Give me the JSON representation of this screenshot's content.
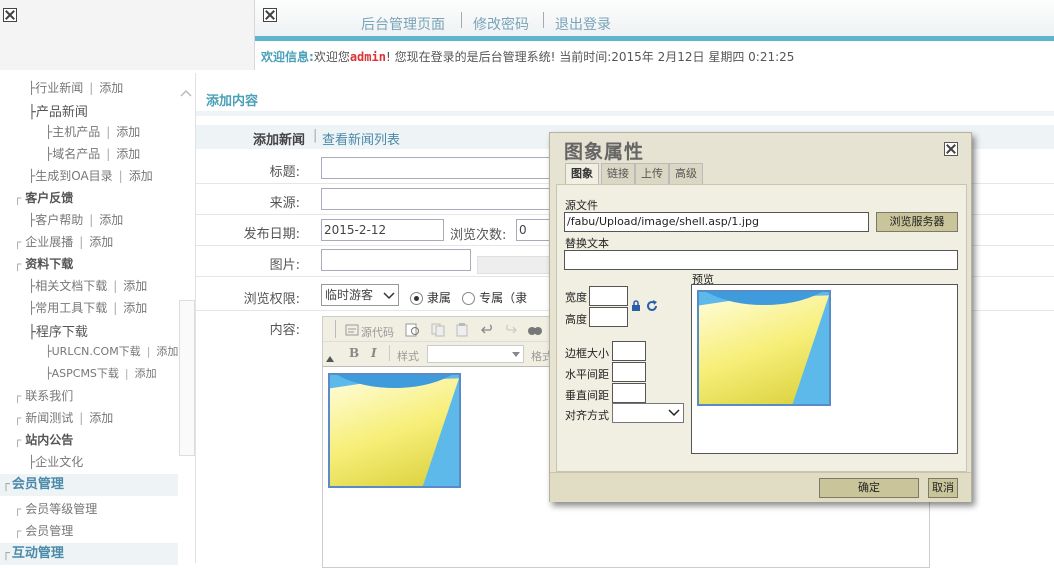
{
  "top_nav": [
    "后台管理页面",
    "修改密码",
    "退出登录"
  ],
  "welcome": {
    "label": "欢迎信息:",
    "prefix": "欢迎您",
    "user": "admin",
    "rest": "! 您现在登录的是后台管理系统! 当前时间:2015年 2月12日 星期四 0:21:25"
  },
  "sidebar": {
    "items": [
      {
        "name": "├行业新闻",
        "action": "添加"
      },
      {
        "name": "├产品新闻",
        "action": ""
      },
      {
        "name": "├主机产品",
        "action": "添加"
      },
      {
        "name": "├域名产品",
        "action": "添加"
      },
      {
        "name": "├生成到OA目录",
        "action": "添加"
      },
      {
        "name": "客户反馈",
        "action": ""
      },
      {
        "name": "├客户帮助",
        "action": "添加"
      },
      {
        "name": "企业展播",
        "action": "添加"
      },
      {
        "name": "资料下载",
        "action": ""
      },
      {
        "name": "├相关文档下载",
        "action": "添加"
      },
      {
        "name": "├常用工具下载",
        "action": "添加"
      },
      {
        "name": "├程序下载",
        "action": ""
      },
      {
        "name": "├URLCN.COM下载",
        "action": "添加"
      },
      {
        "name": "├ASPCMS下载",
        "action": "添加"
      },
      {
        "name": "联系我们",
        "action": ""
      },
      {
        "name": "新闻测试",
        "action": "添加"
      },
      {
        "name": "站内公告",
        "action": ""
      },
      {
        "name": "├企业文化",
        "action": ""
      }
    ],
    "member_section": "会员管理",
    "member_items": [
      "会员等级管理",
      "会员管理"
    ],
    "interact_section": "互动管理"
  },
  "main": {
    "title": "添加内容",
    "tab_add": "添加新闻",
    "tab_list": "查看新闻列表",
    "labels": {
      "title": "标题:",
      "source": "来源:",
      "date": "发布日期:",
      "views": "浏览次数:",
      "image": "图片:",
      "permission": "浏览权限:",
      "content": "内容:"
    },
    "values": {
      "date": "2015-2-12",
      "views": "0",
      "permission": "临时游客",
      "radio1": "隶属",
      "radio2": "专属（隶"
    },
    "editor": {
      "source": "源代码",
      "style": "样式",
      "format": "格式"
    }
  },
  "dialog": {
    "title": "图象属性",
    "tabs": [
      "图象",
      "链接",
      "上传",
      "高级"
    ],
    "source_label": "源文件",
    "source_value": "/fabu/Upload/image/shell.asp/1.jpg",
    "browse_button": "浏览服务器",
    "alt_label": "替换文本",
    "alt_value": "",
    "width_label": "宽度",
    "height_label": "高度",
    "border_label": "边框大小",
    "hspace_label": "水平间距",
    "vspace_label": "垂直间距",
    "align_label": "对齐方式",
    "preview_label": "预览",
    "ok": "确定",
    "cancel": "取消"
  },
  "colors": {
    "accent": "#5fb6cc",
    "section_bg": "#eef3f6",
    "dialog_bg": "#e6e3d2"
  }
}
